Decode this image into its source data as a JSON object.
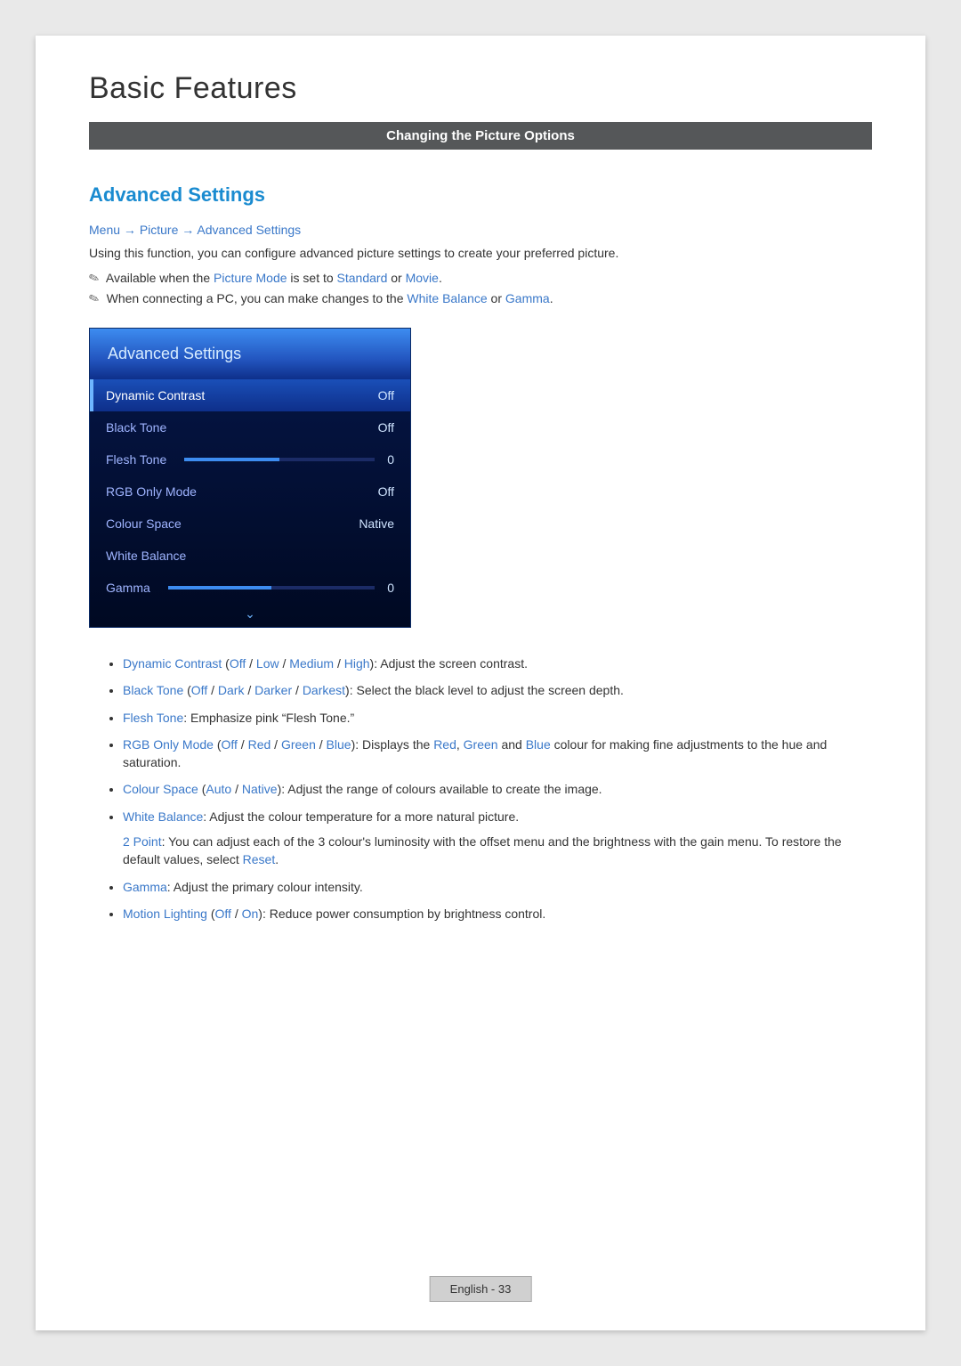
{
  "header": {
    "title": "Basic Features",
    "subbar": "Changing the Picture Options"
  },
  "section": {
    "title": "Advanced Settings",
    "breadcrumb": {
      "menu": "Menu",
      "arrow1": " → ",
      "picture": "Picture",
      "arrow2": " → ",
      "advanced": "Advanced Settings"
    },
    "intro": "Using this function, you can configure advanced picture settings to create your preferred picture.",
    "note1": {
      "prefix": "Available when the ",
      "picture_mode": "Picture Mode",
      "mid": " is set to ",
      "standard": "Standard",
      "or": " or ",
      "movie": "Movie",
      "suffix": "."
    },
    "note2": {
      "prefix": "When connecting a PC, you can make changes to the ",
      "white_balance": "White Balance",
      "or": " or ",
      "gamma": "Gamma",
      "suffix": "."
    }
  },
  "panel": {
    "title": "Advanced Settings",
    "rows": [
      {
        "label": "Dynamic Contrast",
        "value": "Off",
        "selected": true,
        "slider": false
      },
      {
        "label": "Black Tone",
        "value": "Off",
        "selected": false,
        "slider": false
      },
      {
        "label": "Flesh Tone",
        "value": "0",
        "selected": false,
        "slider": true
      },
      {
        "label": "RGB Only Mode",
        "value": "Off",
        "selected": false,
        "slider": false
      },
      {
        "label": "Colour Space",
        "value": "Native",
        "selected": false,
        "slider": false
      },
      {
        "label": "White Balance",
        "value": "",
        "selected": false,
        "slider": false
      },
      {
        "label": "Gamma",
        "value": "0",
        "selected": false,
        "slider": true
      }
    ]
  },
  "bullets": {
    "b0": {
      "name": "Dynamic Contrast",
      "opts": [
        "Off",
        "Low",
        "Medium",
        "High"
      ],
      "desc": ": Adjust the screen contrast."
    },
    "b1": {
      "name": "Black Tone",
      "opts": [
        "Off",
        "Dark",
        "Darker",
        "Darkest"
      ],
      "desc": ": Select the black level to adjust the screen depth."
    },
    "b2": {
      "name": "Flesh Tone",
      "desc": ": Emphasize pink “Flesh Tone.”"
    },
    "b3": {
      "name": "RGB Only Mode",
      "opts": [
        "Off",
        "Red",
        "Green",
        "Blue"
      ],
      "desc_pre": ": Displays the ",
      "red": "Red",
      "c1": ", ",
      "green": "Green",
      "and": " and ",
      "blue": "Blue",
      "desc_post": " colour for making fine adjustments to the hue and saturation."
    },
    "b4": {
      "name": "Colour Space",
      "opts": [
        "Auto",
        "Native"
      ],
      "desc": ": Adjust the range of colours available to create the image."
    },
    "b5": {
      "name": "White Balance",
      "desc": ": Adjust the colour temperature for a more natural picture.",
      "sub_name": "2 Point",
      "sub_desc_pre": ": You can adjust each of the 3 colour's luminosity with the offset menu and the brightness with the gain menu. To restore the default values, select ",
      "reset": "Reset",
      "sub_desc_post": "."
    },
    "b6": {
      "name": "Gamma",
      "desc": ": Adjust the primary colour intensity."
    },
    "b7": {
      "name": "Motion Lighting",
      "opts": [
        "Off",
        "On"
      ],
      "desc": ": Reduce power consumption by brightness control."
    }
  },
  "footer": "English - 33"
}
